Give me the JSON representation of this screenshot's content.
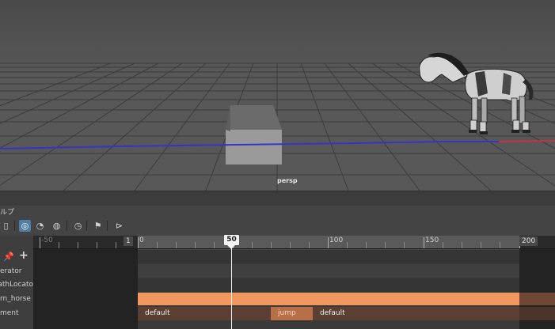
{
  "viewport": {
    "camera_label": "persp"
  },
  "editor": {
    "menu_partial": "ルプ",
    "toolbar_icons": [
      "key-frame-icon",
      "sequencer-icon",
      "create-clip-icon",
      "blend-icon",
      "time-warp-icon",
      "filter-icon",
      "pose-icon"
    ]
  },
  "ruler": {
    "labels": [
      "-50",
      "0",
      "100",
      "150"
    ],
    "start_frame": "1",
    "end_frame": "200",
    "current_frame": "50"
  },
  "tracks": {
    "labels": [
      "erator",
      "pathLocato",
      "rn_horse",
      "ment"
    ]
  },
  "clips": {
    "default_1": "default",
    "jump": "jump",
    "default_2": "default"
  },
  "colors": {
    "horse_track": "#f2975e",
    "jump_clip": "#b86e46",
    "default_clip": "#5c3f33",
    "active_tool": "#4f7fa6",
    "grid_line": "#3c3c3c",
    "path_curve": "#3535c8",
    "x_axis": "#c83246"
  }
}
